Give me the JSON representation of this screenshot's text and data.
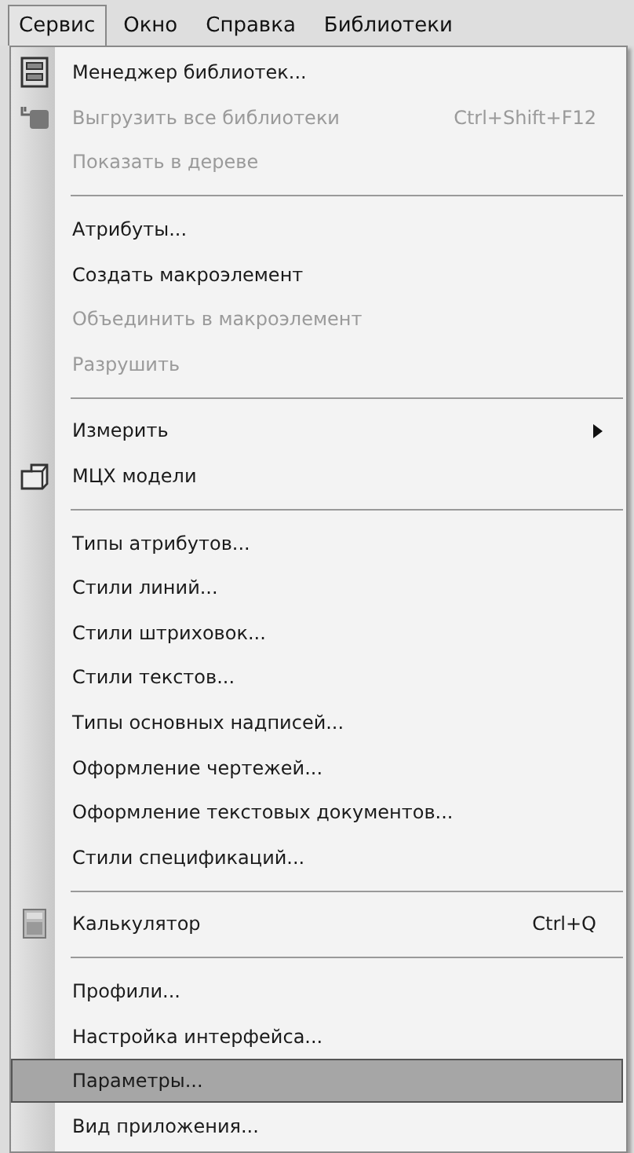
{
  "menu_bar": [
    {
      "label": "Сервис",
      "selected": true
    },
    {
      "label": "Окно",
      "selected": false
    },
    {
      "label": "Справка",
      "selected": false
    },
    {
      "label": "Библиотеки",
      "selected": false
    }
  ],
  "menu": [
    {
      "kind": "item",
      "label": "Менеджер библиотек...",
      "disabled": false,
      "selected": false
    },
    {
      "kind": "item",
      "label": "Выгрузить все библиотеки",
      "shortcut": "Ctrl+Shift+F12",
      "disabled": true,
      "selected": false
    },
    {
      "kind": "item",
      "label": "Показать в дереве",
      "disabled": true,
      "selected": false
    },
    {
      "kind": "separator"
    },
    {
      "kind": "item",
      "label": "Атрибуты...",
      "disabled": false,
      "selected": false
    },
    {
      "kind": "item",
      "label": "Создать макроэлемент",
      "disabled": false,
      "selected": false
    },
    {
      "kind": "item",
      "label": "Объединить в макроэлемент",
      "disabled": true,
      "selected": false
    },
    {
      "kind": "item",
      "label": "Разрушить",
      "disabled": true,
      "selected": false
    },
    {
      "kind": "separator"
    },
    {
      "kind": "item",
      "label": "Измерить",
      "submenu": true,
      "disabled": false,
      "selected": false
    },
    {
      "kind": "item",
      "label": "МЦХ модели",
      "disabled": false,
      "selected": false
    },
    {
      "kind": "separator"
    },
    {
      "kind": "item",
      "label": "Типы атрибутов...",
      "disabled": false,
      "selected": false
    },
    {
      "kind": "item",
      "label": "Стили линий...",
      "disabled": false,
      "selected": false
    },
    {
      "kind": "item",
      "label": "Стили штриховок...",
      "disabled": false,
      "selected": false
    },
    {
      "kind": "item",
      "label": "Стили текстов...",
      "disabled": false,
      "selected": false
    },
    {
      "kind": "item",
      "label": "Типы основных надписей...",
      "disabled": false,
      "selected": false
    },
    {
      "kind": "item",
      "label": "Оформление чертежей...",
      "disabled": false,
      "selected": false
    },
    {
      "kind": "item",
      "label": "Оформление текстовых документов...",
      "disabled": false,
      "selected": false
    },
    {
      "kind": "item",
      "label": "Стили спецификаций...",
      "disabled": false,
      "selected": false
    },
    {
      "kind": "separator"
    },
    {
      "kind": "item",
      "label": "Калькулятор",
      "shortcut": "Ctrl+Q",
      "disabled": false,
      "selected": false
    },
    {
      "kind": "separator"
    },
    {
      "kind": "item",
      "label": "Профили...",
      "disabled": false,
      "selected": false
    },
    {
      "kind": "item",
      "label": "Настройка интерфейса...",
      "disabled": false,
      "selected": false
    },
    {
      "kind": "item",
      "label": "Параметры...",
      "disabled": false,
      "selected": true
    },
    {
      "kind": "item",
      "label": "Вид приложения...",
      "disabled": false,
      "selected": false
    }
  ]
}
